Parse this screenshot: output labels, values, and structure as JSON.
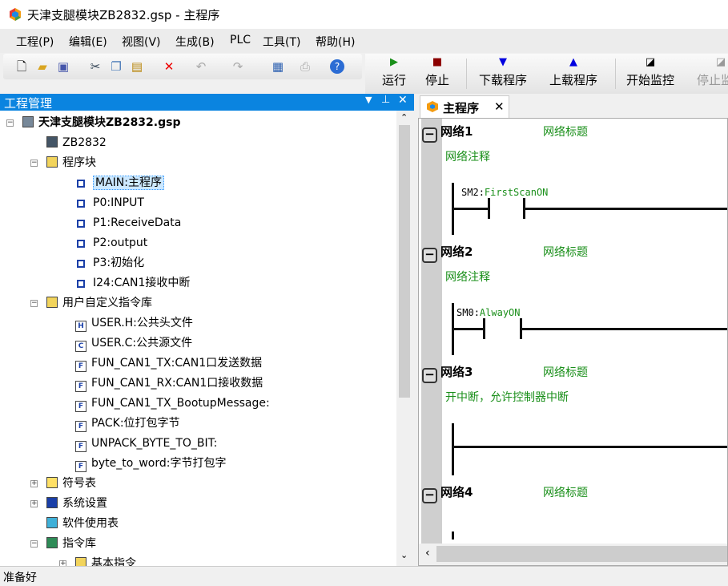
{
  "window": {
    "title": "天津支腿模块ZB2832.gsp - 主程序",
    "app_icon": "hexagon-logo-icon"
  },
  "menu": [
    "工程(P)",
    "编辑(E)",
    "视图(V)",
    "生成(B)",
    "PLC",
    "工具(T)",
    "帮助(H)"
  ],
  "toolbar": {
    "icons": [
      "new-file-icon",
      "open-folder-icon",
      "save-icon",
      "cut-icon",
      "copy-icon",
      "paste-icon",
      "delete-icon",
      "undo-icon",
      "redo-icon",
      "calendar-icon",
      "print-icon",
      "help-icon"
    ]
  },
  "plc_toolbar": [
    {
      "label": "运行",
      "icon": "play-icon",
      "color": "#1a8f1a"
    },
    {
      "label": "停止",
      "icon": "stop-icon",
      "color": "#8b0000"
    },
    {
      "label": "下载程序",
      "icon": "download-icon",
      "color": "#0000e0"
    },
    {
      "label": "上载程序",
      "icon": "upload-icon",
      "color": "#0000e0"
    },
    {
      "label": "开始监控",
      "icon": "monitor-icon"
    },
    {
      "label": "停止监控",
      "icon": "stop-monitor-icon",
      "disabled": true
    }
  ],
  "project_panel": {
    "title": "工程管理"
  },
  "tree": [
    {
      "label": "天津支腿模块ZB2832.gsp",
      "level": 0,
      "bold": true,
      "icon": "project-icon"
    },
    {
      "label": "ZB2832",
      "level": 1,
      "icon": "plc-icon"
    },
    {
      "label": "程序块",
      "level": 1,
      "icon": "folder-icon"
    },
    {
      "label": "MAIN:主程序",
      "level": 2,
      "icon": "program-icon",
      "selected": true
    },
    {
      "label": "P0:INPUT",
      "level": 2,
      "icon": "program-icon"
    },
    {
      "label": "P1:ReceiveData",
      "level": 2,
      "icon": "program-icon"
    },
    {
      "label": "P2:output",
      "level": 2,
      "icon": "program-icon"
    },
    {
      "label": "P3:初始化",
      "level": 2,
      "icon": "program-icon"
    },
    {
      "label": "I24:CAN1接收中断",
      "level": 2,
      "icon": "program-icon"
    },
    {
      "label": "用户自定义指令库",
      "level": 1,
      "icon": "function-folder-icon"
    },
    {
      "label": "USER.H:公共头文件",
      "level": 2,
      "icon": "header-file-icon",
      "glyph": "H"
    },
    {
      "label": "USER.C:公共源文件",
      "level": 2,
      "icon": "source-file-icon",
      "glyph": "C"
    },
    {
      "label": "FUN_CAN1_TX:CAN1口发送数据",
      "level": 2,
      "icon": "function-icon",
      "glyph": "F"
    },
    {
      "label": "FUN_CAN1_RX:CAN1口接收数据",
      "level": 2,
      "icon": "function-icon",
      "glyph": "F"
    },
    {
      "label": "FUN_CAN1_TX_BootupMessage:",
      "level": 2,
      "icon": "function-icon",
      "glyph": "F"
    },
    {
      "label": "PACK:位打包字节",
      "level": 2,
      "icon": "function-icon",
      "glyph": "F"
    },
    {
      "label": "UNPACK_BYTE_TO_BIT:",
      "level": 2,
      "icon": "function-icon",
      "glyph": "F"
    },
    {
      "label": "byte_to_word:字节打包字",
      "level": 2,
      "icon": "function-icon",
      "glyph": "F"
    },
    {
      "label": "符号表",
      "level": 1,
      "icon": "symbol-table-icon"
    },
    {
      "label": "系统设置",
      "level": 1,
      "icon": "grid-icon"
    },
    {
      "label": "软件使用表",
      "level": 1,
      "icon": "usage-table-icon"
    },
    {
      "label": "指令库",
      "level": 1,
      "icon": "library-icon"
    },
    {
      "label": "基本指令",
      "level": 2,
      "icon": "folder-icon"
    }
  ],
  "editor": {
    "tab": "主程序",
    "networks": [
      {
        "name": "网络1",
        "title": "网络标题",
        "comment": "网络注释",
        "contact": "SM2",
        "contact_comment": "FirstScanON"
      },
      {
        "name": "网络2",
        "title": "网络标题",
        "comment": "网络注释",
        "contact": "SM0",
        "contact_comment": "AlwayON"
      },
      {
        "name": "网络3",
        "title": "网络标题",
        "comment": "开中断，允许控制器中断"
      },
      {
        "name": "网络4",
        "title": "网络标题"
      }
    ]
  },
  "status": "准备好"
}
